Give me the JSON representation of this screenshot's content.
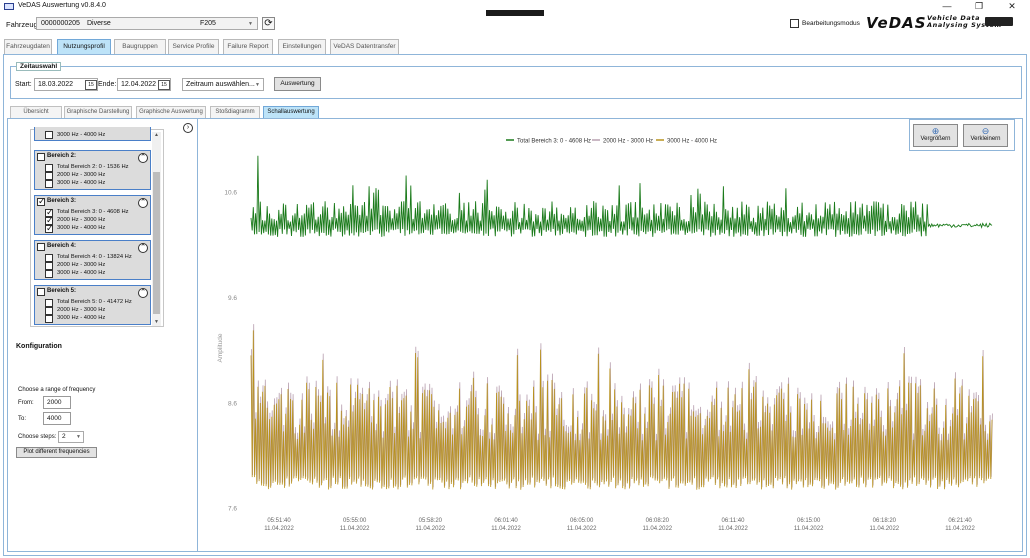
{
  "window": {
    "title": "VeDAS Auswertung v0.8.4.0",
    "controls": [
      "—",
      "❐",
      "✕"
    ]
  },
  "vehicle": {
    "label": "Fahrzeug:",
    "id": "0000000205",
    "name": "Diverse",
    "code": "F205",
    "edit_mode_label": "Bearbeitungsmodus",
    "edit_mode_checked": false
  },
  "logo": {
    "text": "VeDAS",
    "sub_line1": "Vehicle Data",
    "sub_line2": "Analysing System"
  },
  "main_tabs": [
    {
      "label": "Fahrzeugdaten",
      "active": false
    },
    {
      "label": "Nutzungsprofil",
      "active": true
    },
    {
      "label": "Baugruppen",
      "active": false
    },
    {
      "label": "Service Profile",
      "active": false
    },
    {
      "label": "Failure Report",
      "active": false
    },
    {
      "label": "Einstellungen",
      "active": false
    },
    {
      "label": "VeDAS Datentransfer",
      "active": false
    }
  ],
  "zeitauswahl": {
    "title": "Zeitauswahl",
    "start_label": "Start:",
    "start_value": "18.03.2022",
    "end_label": "Ende:",
    "end_value": "12.04.2022",
    "calendar_icon_text": "15",
    "range_select": "Zeitraum auswählen...",
    "button": "Auswertung"
  },
  "sub_tabs": [
    {
      "label": "Übersicht",
      "active": false
    },
    {
      "label": "Graphische Darstellung",
      "active": false
    },
    {
      "label": "Graphische Auswertung",
      "active": false
    },
    {
      "label": "Stoßdiagramm",
      "active": false
    },
    {
      "label": "Schallauswertung",
      "active": true
    }
  ],
  "bereich_list": {
    "top_partial_item": "3000 Hz - 4000 Hz",
    "groups": [
      {
        "title": "Bereich 2:",
        "checked": false,
        "items": [
          {
            "label": "Total Bereich 2: 0 - 1536 Hz",
            "checked": false
          },
          {
            "label": "2000 Hz - 3000 Hz",
            "checked": false
          },
          {
            "label": "3000 Hz - 4000 Hz",
            "checked": false
          }
        ]
      },
      {
        "title": "Bereich 3:",
        "checked": true,
        "items": [
          {
            "label": "Total Bereich 3: 0 - 4608 Hz",
            "checked": true
          },
          {
            "label": "2000 Hz - 3000 Hz",
            "checked": true
          },
          {
            "label": "3000 Hz - 4000 Hz",
            "checked": true
          }
        ]
      },
      {
        "title": "Bereich 4:",
        "checked": false,
        "items": [
          {
            "label": "Total Bereich 4: 0 - 13824 Hz",
            "checked": false
          },
          {
            "label": "2000 Hz - 3000 Hz",
            "checked": false
          },
          {
            "label": "3000 Hz - 4000 Hz",
            "checked": false
          }
        ]
      },
      {
        "title": "Bereich 5:",
        "checked": false,
        "items": [
          {
            "label": "Total Bereich 5: 0 - 41472 Hz",
            "checked": false
          },
          {
            "label": "2000 Hz - 3000 Hz",
            "checked": false
          },
          {
            "label": "3000 Hz - 4000 Hz",
            "checked": false
          }
        ]
      }
    ]
  },
  "konfiguration": {
    "title": "Konfiguration",
    "range_label": "Choose a range of frequency",
    "from_label": "From:",
    "from_value": "2000",
    "to_label": "To:",
    "to_value": "4000",
    "steps_label": "Choose steps:",
    "steps_value": "2",
    "plot_button": "Plot different frequencies"
  },
  "zoom": {
    "in_label": "Vergrößern",
    "out_label": "Verkleinern"
  },
  "colors": {
    "accent_tab": "#bde3f8",
    "frame": "#8fb5d9",
    "series_total": "#1a7a1a",
    "series_2000": "#b8a0b0",
    "series_3000": "#b8921e"
  },
  "chart_data": {
    "type": "line",
    "title": "",
    "xlabel": "",
    "ylabel": "Amplitude",
    "yticks": [
      7.6,
      8.6,
      9.6,
      10.6
    ],
    "ylim": [
      7.55,
      11.1
    ],
    "x_ticks": [
      {
        "time": "05:51:40",
        "date": "11.04.2022"
      },
      {
        "time": "05:55:00",
        "date": "11.04.2022"
      },
      {
        "time": "05:58:20",
        "date": "11.04.2022"
      },
      {
        "time": "06:01:40",
        "date": "11.04.2022"
      },
      {
        "time": "06:05:00",
        "date": "11.04.2022"
      },
      {
        "time": "06:08:20",
        "date": "11.04.2022"
      },
      {
        "time": "06:11:40",
        "date": "11.04.2022"
      },
      {
        "time": "06:15:00",
        "date": "11.04.2022"
      },
      {
        "time": "06:18:20",
        "date": "11.04.2022"
      },
      {
        "time": "06:21:40",
        "date": "11.04.2022"
      }
    ],
    "legend_position": "top-center",
    "grid": false,
    "series": [
      {
        "name": "Total Bereich 3: 0 - 4608 Hz",
        "color": "#1a7a1a",
        "approx_range": [
          10.15,
          10.95
        ]
      },
      {
        "name": "2000 Hz - 3000 Hz",
        "color": "#b8a0b0",
        "approx_range": [
          7.75,
          8.95
        ]
      },
      {
        "name": "3000 Hz - 4000 Hz",
        "color": "#b8921e",
        "approx_range": [
          7.75,
          8.95
        ]
      }
    ]
  }
}
